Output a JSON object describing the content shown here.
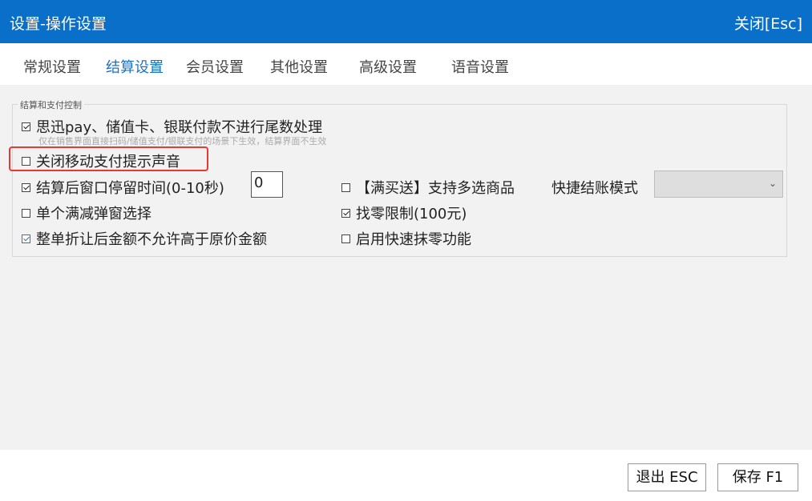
{
  "window": {
    "title": "设置-操作设置",
    "close_label": "关闭[Esc]"
  },
  "tabs": [
    {
      "label": "常规设置",
      "active": false
    },
    {
      "label": "结算设置",
      "active": true
    },
    {
      "label": "会员设置",
      "active": false
    },
    {
      "label": "其他设置",
      "active": false
    },
    {
      "label": "高级设置",
      "active": false
    },
    {
      "label": "语音设置",
      "active": false
    }
  ],
  "group": {
    "legend": "结算和支付控制"
  },
  "options": {
    "no_rounding": {
      "label": "思迅pay、储值卡、银联付款不进行尾数处理",
      "checked": true
    },
    "no_rounding_hint": "仅在销售界面直接扫码/储值支付/银联支付的场景下生效，结算界面不生效",
    "mute_mobile_pay": {
      "label": "关闭移动支付提示声音",
      "checked": false
    },
    "window_stay": {
      "label": "结算后窗口停留时间(0-10秒)",
      "checked": true,
      "value": "0"
    },
    "single_discount_popup": {
      "label": "单个满减弹窗选择",
      "checked": false
    },
    "no_exceed_original": {
      "label": "整单折让后金额不允许高于原价金额",
      "checked": true
    },
    "multi_select_gift": {
      "label": "【满买送】支持多选商品",
      "checked": false
    },
    "change_limit": {
      "label": "找零限制(100元)",
      "checked": true
    },
    "quick_wipe": {
      "label": "启用快速抹零功能",
      "checked": false
    },
    "quick_checkout_mode": {
      "label": "快捷结账模式",
      "value": ""
    }
  },
  "footer": {
    "exit_label": "退出 ESC",
    "save_label": "保存 F1"
  },
  "colors": {
    "titlebar": "#0a6fc9",
    "active_tab": "#1a73c9",
    "highlight": "#e53935"
  }
}
